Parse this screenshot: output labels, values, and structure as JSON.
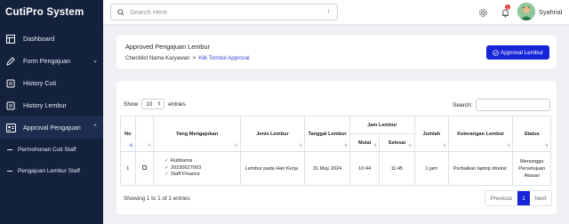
{
  "app": {
    "title": "CutiPro System"
  },
  "sidebar": {
    "items": [
      {
        "label": "Dashboard",
        "icon": "grid-icon"
      },
      {
        "label": "Form Pengajuan",
        "icon": "pencil-icon",
        "chevron": "⌄"
      },
      {
        "label": "History Cuti",
        "icon": "history-icon"
      },
      {
        "label": "History Lembur",
        "icon": "history-icon"
      },
      {
        "label": "Approval Pengajuan",
        "icon": "approval-icon",
        "chevron": "⌃"
      }
    ],
    "sub_items": [
      {
        "label": "Permohonan Cuti Staff"
      },
      {
        "label": "Pengajuan Lembur Staff"
      }
    ]
  },
  "topbar": {
    "search_placeholder": "Search Here",
    "search_arrow": "↓",
    "notification_count": "1",
    "username": "Syahrial"
  },
  "header": {
    "title": "Approved Pengajuan Lembur",
    "breadcrumb_1": "Checklist Nama Karyawan",
    "breadcrumb_sep": ">",
    "breadcrumb_2": "Klik Tombol Approval",
    "approve_button": "Approval Lembur",
    "approve_icon": "check-circle-icon"
  },
  "table_controls": {
    "show_label": "Show",
    "entries_value": "10",
    "entries_label": "entries",
    "search_label": "Search:"
  },
  "table": {
    "headers": {
      "no": "No",
      "pengaju": "Yang Mengajukan",
      "jenis": "Jenis Lembur",
      "tanggal": "Tanggal Lembur",
      "jam": "Jam Lembur",
      "mulai": "Mulai",
      "selesai": "Selesai",
      "jumlah": "Jumlah",
      "keterangan": "Keterangan Lembur",
      "status": "Status"
    },
    "rows": [
      {
        "no": "1",
        "name": "Rubbama",
        "nik": "20230627003",
        "dept": "Staff Finance",
        "jenis": "Lembur pada Hari Kerja",
        "tanggal": "31 May 2024",
        "mulai": "10:44",
        "selesai": "11:45",
        "jumlah": "1 jam",
        "keterangan": "Perbaikan laptop direksi",
        "status": "Menunggu Persetujuan Atasan"
      }
    ]
  },
  "footer": {
    "info": "Showing 1 to 1 of 1 entries",
    "prev": "Previous",
    "page": "1",
    "next": "Next"
  },
  "colors": {
    "sidebar": "#14213d",
    "accent": "#1725d8",
    "link": "#3b46d6"
  }
}
